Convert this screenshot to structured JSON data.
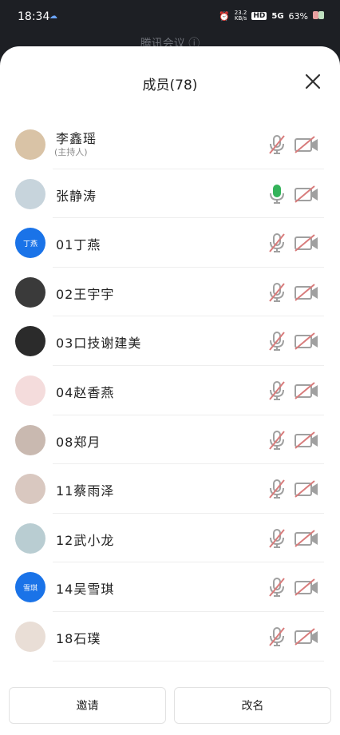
{
  "status_bar": {
    "time": "18:34",
    "speed_value": "23.2",
    "speed_unit": "KB/s",
    "hd_badge": "HD",
    "network": "5G",
    "battery": "63%"
  },
  "background_title": "腾讯会议 ⓘ",
  "sheet": {
    "title": "成员(78)",
    "close_icon": "close-icon"
  },
  "colors": {
    "mic_muted": "#d87b7b",
    "mic_active": "#34b35a",
    "avatar_blue": "#1a73e8",
    "icon_gray": "#a0a0a0"
  },
  "members": [
    {
      "name": "李鑫瑶",
      "sub": "(主持人)",
      "avatar_text": "",
      "avatar_color": "#d9c3a6",
      "mic_active": false
    },
    {
      "name": "张静涛",
      "sub": "",
      "avatar_text": "",
      "avatar_color": "#c7d4dc",
      "mic_active": true
    },
    {
      "name": "01丁燕",
      "sub": "",
      "avatar_text": "丁燕",
      "avatar_color": "#1a73e8",
      "mic_active": false
    },
    {
      "name": "02王宇宇",
      "sub": "",
      "avatar_text": "",
      "avatar_color": "#3a3a3a",
      "mic_active": false
    },
    {
      "name": "03口技谢建美",
      "sub": "",
      "avatar_text": "",
      "avatar_color": "#2b2b2b",
      "mic_active": false
    },
    {
      "name": "04赵香燕",
      "sub": "",
      "avatar_text": "",
      "avatar_color": "#f4dcdc",
      "mic_active": false
    },
    {
      "name": "08郑月",
      "sub": "",
      "avatar_text": "",
      "avatar_color": "#c9b9b0",
      "mic_active": false
    },
    {
      "name": "11蔡雨泽",
      "sub": "",
      "avatar_text": "",
      "avatar_color": "#d9c8c0",
      "mic_active": false
    },
    {
      "name": "12武小龙",
      "sub": "",
      "avatar_text": "",
      "avatar_color": "#b9cdd2",
      "mic_active": false
    },
    {
      "name": "14吴雪琪",
      "sub": "",
      "avatar_text": "雪琪",
      "avatar_color": "#1a73e8",
      "mic_active": false
    },
    {
      "name": "18石璞",
      "sub": "",
      "avatar_text": "",
      "avatar_color": "#e9ded6",
      "mic_active": false
    }
  ],
  "actions": {
    "invite": "邀请",
    "rename": "改名"
  }
}
